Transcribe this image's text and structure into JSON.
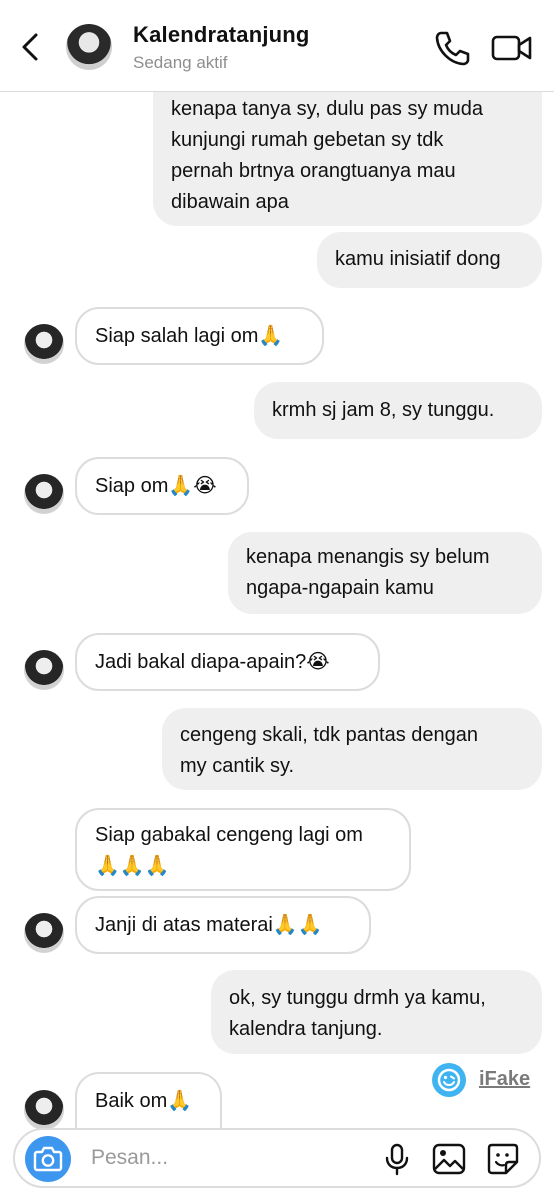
{
  "header": {
    "title": "Kalendratanjung",
    "status": "Sedang aktif"
  },
  "messages": [
    {
      "dir": "out",
      "lines": [
        "kenapa tanya sy, dulu pas sy muda",
        "kunjungi rumah gebetan sy tdk",
        "pernah brtnya orangtuanya mau",
        "dibawain apa"
      ]
    },
    {
      "dir": "out",
      "lines": [
        "kamu inisiatif dong"
      ]
    },
    {
      "dir": "in",
      "lines": [
        "Siap salah lagi om🙏"
      ]
    },
    {
      "dir": "out",
      "lines": [
        "krmh sj jam 8, sy tunggu."
      ]
    },
    {
      "dir": "in",
      "lines": [
        "Siap om🙏😭"
      ]
    },
    {
      "dir": "out",
      "lines": [
        "kenapa menangis sy belum",
        "ngapa-ngapain kamu"
      ]
    },
    {
      "dir": "in",
      "lines": [
        "Jadi bakal diapa-apain?😭"
      ]
    },
    {
      "dir": "out",
      "lines": [
        "cengeng skali, tdk pantas dengan",
        "my cantik sy."
      ]
    },
    {
      "dir": "in",
      "lines": [
        "Siap gabakal cengeng lagi om",
        "🙏🙏🙏"
      ]
    },
    {
      "dir": "in",
      "lines": [
        "Janji di atas materai🙏🙏"
      ]
    },
    {
      "dir": "out",
      "lines": [
        "ok, sy tunggu drmh ya kamu,",
        "kalendra tanjung."
      ]
    },
    {
      "dir": "in",
      "lines": [
        "Baik om🙏"
      ]
    }
  ],
  "watermark": {
    "label": "iFake"
  },
  "composer": {
    "placeholder": "Pesan..."
  },
  "icons": {
    "back": "chevron-left-icon",
    "call": "phone-icon",
    "video": "video-camera-icon",
    "camera": "camera-icon",
    "mic": "microphone-icon",
    "gallery": "image-icon",
    "sticker": "sticker-icon"
  },
  "colors": {
    "outgoing_bubble": "#efefef",
    "incoming_border": "#dcdcdc",
    "camera_button": "#3e97ef",
    "ifake": "#3fb4f0"
  }
}
